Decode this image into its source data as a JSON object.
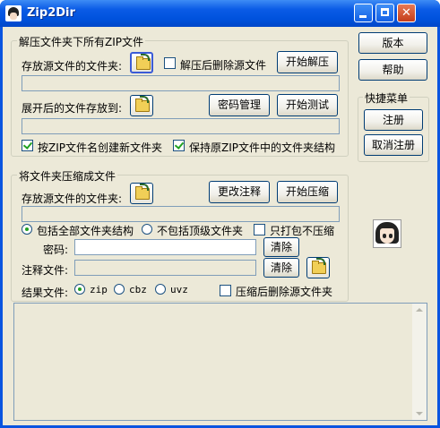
{
  "window": {
    "title": "Zip2Dir"
  },
  "extract_group": {
    "title": "解压文件夹下所有ZIP文件",
    "source_label": "存放源文件的文件夹:",
    "delete_after_label": "解压后删除源文件",
    "start_extract": "开始解压",
    "output_label": "展开后的文件存放到:",
    "password_manage": "密码管理",
    "start_test": "开始测试",
    "create_by_name_label": "按ZIP文件名创建新文件夹",
    "keep_structure_label": "保持原ZIP文件中的文件夹结构"
  },
  "compress_group": {
    "title": "将文件夹压缩成文件",
    "source_label": "存放源文件的文件夹:",
    "change_comment": "更改注释",
    "start_compress": "开始压缩",
    "include_all_label": "包括全部文件夹结构",
    "exclude_top_label": "不包括顶级文件夹",
    "pack_only_label": "只打包不压缩",
    "password_label": "密码:",
    "password_value": "",
    "clear_password": "清除",
    "comment_label": "注释文件:",
    "clear_comment": "清除",
    "result_label": "结果文件:",
    "format_zip": "zip",
    "format_cbz": "cbz",
    "format_uvz": "uvz",
    "delete_after_label": "压缩后删除源文件夹"
  },
  "side": {
    "version": "版本",
    "help": "帮助",
    "quick_menu_title": "快捷菜单",
    "register": "注册",
    "unregister": "取消注册"
  }
}
